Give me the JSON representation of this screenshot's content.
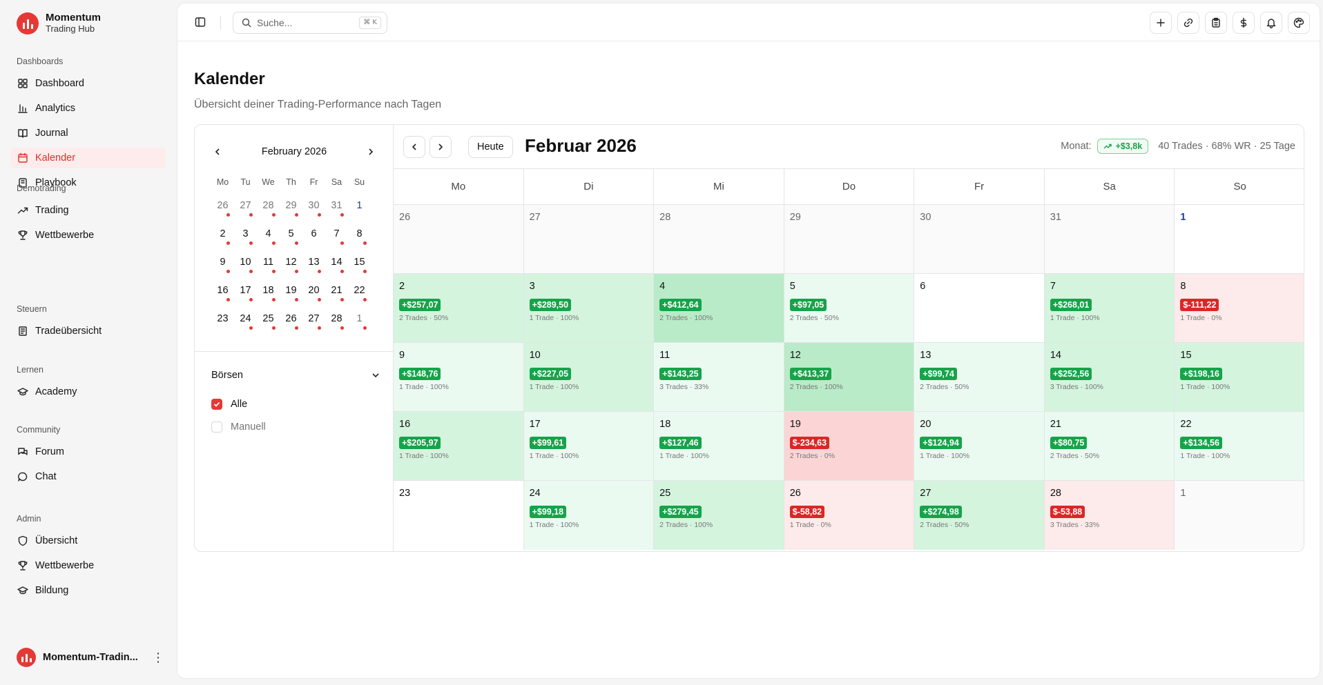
{
  "brand": {
    "title": "Momentum",
    "subtitle": "Trading Hub"
  },
  "sidebar": {
    "groups": [
      {
        "heading": "Dashboards",
        "items": [
          {
            "label": "Dashboard",
            "icon": "grid-icon"
          },
          {
            "label": "Analytics",
            "icon": "bar-chart-icon"
          },
          {
            "label": "Journal",
            "icon": "book-open-icon"
          },
          {
            "label": "Kalender",
            "icon": "calendar-icon",
            "active": true
          },
          {
            "label": "Playbook",
            "icon": "notebook-icon"
          }
        ]
      },
      {
        "heading": "Demotrading",
        "items": [
          {
            "label": "Trading",
            "icon": "trending-up-icon"
          },
          {
            "label": "Wettbewerbe",
            "icon": "trophy-icon"
          }
        ]
      },
      {
        "heading": "Steuern",
        "items": [
          {
            "label": "Tradeübersicht",
            "icon": "receipt-icon"
          }
        ]
      },
      {
        "heading": "Lernen",
        "items": [
          {
            "label": "Academy",
            "icon": "graduation-cap-icon"
          }
        ]
      },
      {
        "heading": "Community",
        "items": [
          {
            "label": "Forum",
            "icon": "messages-icon"
          },
          {
            "label": "Chat",
            "icon": "message-circle-icon"
          }
        ]
      },
      {
        "heading": "Admin",
        "items": [
          {
            "label": "Übersicht",
            "icon": "shield-icon"
          },
          {
            "label": "Wettbewerbe",
            "icon": "trophy-icon"
          },
          {
            "label": "Bildung",
            "icon": "graduation-cap-icon"
          }
        ]
      }
    ],
    "user": {
      "name": "Momentum-Tradin..."
    }
  },
  "topbar": {
    "search_placeholder": "Suche...",
    "shortcut": "⌘ K",
    "actions": [
      "plus-icon",
      "link-icon",
      "clipboard-icon",
      "dollar-icon",
      "bell-icon",
      "palette-icon"
    ]
  },
  "page": {
    "title": "Kalender",
    "subtitle": "Übersicht deiner Trading-Performance nach Tagen"
  },
  "mini_calendar": {
    "title": "February 2026",
    "weekdays": [
      "Mo",
      "Tu",
      "We",
      "Th",
      "Fr",
      "Sa",
      "Su"
    ],
    "weeks": [
      [
        {
          "d": "26",
          "out": true,
          "dot": true
        },
        {
          "d": "27",
          "out": true,
          "dot": true
        },
        {
          "d": "28",
          "out": true,
          "dot": true
        },
        {
          "d": "29",
          "out": true,
          "dot": true
        },
        {
          "d": "30",
          "out": true,
          "dot": true
        },
        {
          "d": "31",
          "out": true,
          "dot": true
        },
        {
          "d": "1",
          "today": true
        }
      ],
      [
        {
          "d": "2",
          "dot": true
        },
        {
          "d": "3",
          "dot": true
        },
        {
          "d": "4",
          "dot": true
        },
        {
          "d": "5",
          "dot": true
        },
        {
          "d": "6"
        },
        {
          "d": "7",
          "dot": true
        },
        {
          "d": "8",
          "dot": true
        }
      ],
      [
        {
          "d": "9",
          "dot": true
        },
        {
          "d": "10",
          "dot": true
        },
        {
          "d": "11",
          "dot": true
        },
        {
          "d": "12",
          "dot": true
        },
        {
          "d": "13",
          "dot": true
        },
        {
          "d": "14",
          "dot": true
        },
        {
          "d": "15",
          "dot": true
        }
      ],
      [
        {
          "d": "16",
          "dot": true
        },
        {
          "d": "17",
          "dot": true
        },
        {
          "d": "18",
          "dot": true
        },
        {
          "d": "19",
          "dot": true
        },
        {
          "d": "20",
          "dot": true
        },
        {
          "d": "21",
          "dot": true
        },
        {
          "d": "22",
          "dot": true
        }
      ],
      [
        {
          "d": "23"
        },
        {
          "d": "24",
          "dot": true
        },
        {
          "d": "25",
          "dot": true
        },
        {
          "d": "26",
          "dot": true
        },
        {
          "d": "27",
          "dot": true
        },
        {
          "d": "28",
          "dot": true
        },
        {
          "d": "1",
          "out": true,
          "dot": true
        }
      ]
    ]
  },
  "filters": {
    "title": "Börsen",
    "options": [
      {
        "label": "Alle",
        "checked": true
      },
      {
        "label": "Manuell",
        "checked": false
      }
    ]
  },
  "calendar": {
    "today_label": "Heute",
    "title": "Februar 2026",
    "month_label": "Monat:",
    "month_pnl": "+$3,8k",
    "month_stats": "40 Trades · 68% WR · 25 Tage",
    "weekdays": [
      "Mo",
      "Di",
      "Mi",
      "Do",
      "Fr",
      "Sa",
      "So"
    ],
    "colors": {
      "positive": "#16a34a",
      "negative": "#dc2626",
      "accent": "#e53935"
    },
    "weeks": [
      [
        {
          "d": "26",
          "out": true
        },
        {
          "d": "27",
          "out": true
        },
        {
          "d": "28",
          "out": true
        },
        {
          "d": "29",
          "out": true
        },
        {
          "d": "30",
          "out": true
        },
        {
          "d": "31",
          "out": true
        },
        {
          "d": "1",
          "today": true
        }
      ],
      [
        {
          "d": "2",
          "pnl": "+$257,07",
          "meta": "2 Trades · 50%",
          "tone": "g2"
        },
        {
          "d": "3",
          "pnl": "+$289,50",
          "meta": "1 Trade · 100%",
          "tone": "g2"
        },
        {
          "d": "4",
          "pnl": "+$412,64",
          "meta": "2 Trades · 100%",
          "tone": "g3"
        },
        {
          "d": "5",
          "pnl": "+$97,05",
          "meta": "2 Trades · 50%",
          "tone": "g1"
        },
        {
          "d": "6"
        },
        {
          "d": "7",
          "pnl": "+$268,01",
          "meta": "1 Trade · 100%",
          "tone": "g2"
        },
        {
          "d": "8",
          "pnl": "$-111,22",
          "meta": "1 Trade · 0%",
          "tone": "r1",
          "neg": true
        }
      ],
      [
        {
          "d": "9",
          "pnl": "+$148,76",
          "meta": "1 Trade · 100%",
          "tone": "g1"
        },
        {
          "d": "10",
          "pnl": "+$227,05",
          "meta": "1 Trade · 100%",
          "tone": "g2"
        },
        {
          "d": "11",
          "pnl": "+$143,25",
          "meta": "3 Trades · 33%",
          "tone": "g1"
        },
        {
          "d": "12",
          "pnl": "+$413,37",
          "meta": "2 Trades · 100%",
          "tone": "g3"
        },
        {
          "d": "13",
          "pnl": "+$99,74",
          "meta": "2 Trades · 50%",
          "tone": "g1"
        },
        {
          "d": "14",
          "pnl": "+$252,56",
          "meta": "3 Trades · 100%",
          "tone": "g2"
        },
        {
          "d": "15",
          "pnl": "+$198,16",
          "meta": "1 Trade · 100%",
          "tone": "g2"
        }
      ],
      [
        {
          "d": "16",
          "pnl": "+$205,97",
          "meta": "1 Trade · 100%",
          "tone": "g2"
        },
        {
          "d": "17",
          "pnl": "+$99,61",
          "meta": "1 Trade · 100%",
          "tone": "g1"
        },
        {
          "d": "18",
          "pnl": "+$127,46",
          "meta": "1 Trade · 100%",
          "tone": "g1"
        },
        {
          "d": "19",
          "pnl": "$-234,63",
          "meta": "2 Trades · 0%",
          "tone": "r2",
          "neg": true
        },
        {
          "d": "20",
          "pnl": "+$124,94",
          "meta": "1 Trade · 100%",
          "tone": "g1"
        },
        {
          "d": "21",
          "pnl": "+$80,75",
          "meta": "2 Trades · 50%",
          "tone": "g1"
        },
        {
          "d": "22",
          "pnl": "+$134,56",
          "meta": "1 Trade · 100%",
          "tone": "g1"
        }
      ],
      [
        {
          "d": "23"
        },
        {
          "d": "24",
          "pnl": "+$99,18",
          "meta": "1 Trade · 100%",
          "tone": "g1"
        },
        {
          "d": "25",
          "pnl": "+$279,45",
          "meta": "2 Trades · 100%",
          "tone": "g2"
        },
        {
          "d": "26",
          "pnl": "$-58,82",
          "meta": "1 Trade · 0%",
          "tone": "r1",
          "neg": true
        },
        {
          "d": "27",
          "pnl": "+$274,98",
          "meta": "2 Trades · 50%",
          "tone": "g2"
        },
        {
          "d": "28",
          "pnl": "$-53,88",
          "meta": "3 Trades · 33%",
          "tone": "r1",
          "neg": true
        },
        {
          "d": "1",
          "out": true
        }
      ]
    ]
  }
}
